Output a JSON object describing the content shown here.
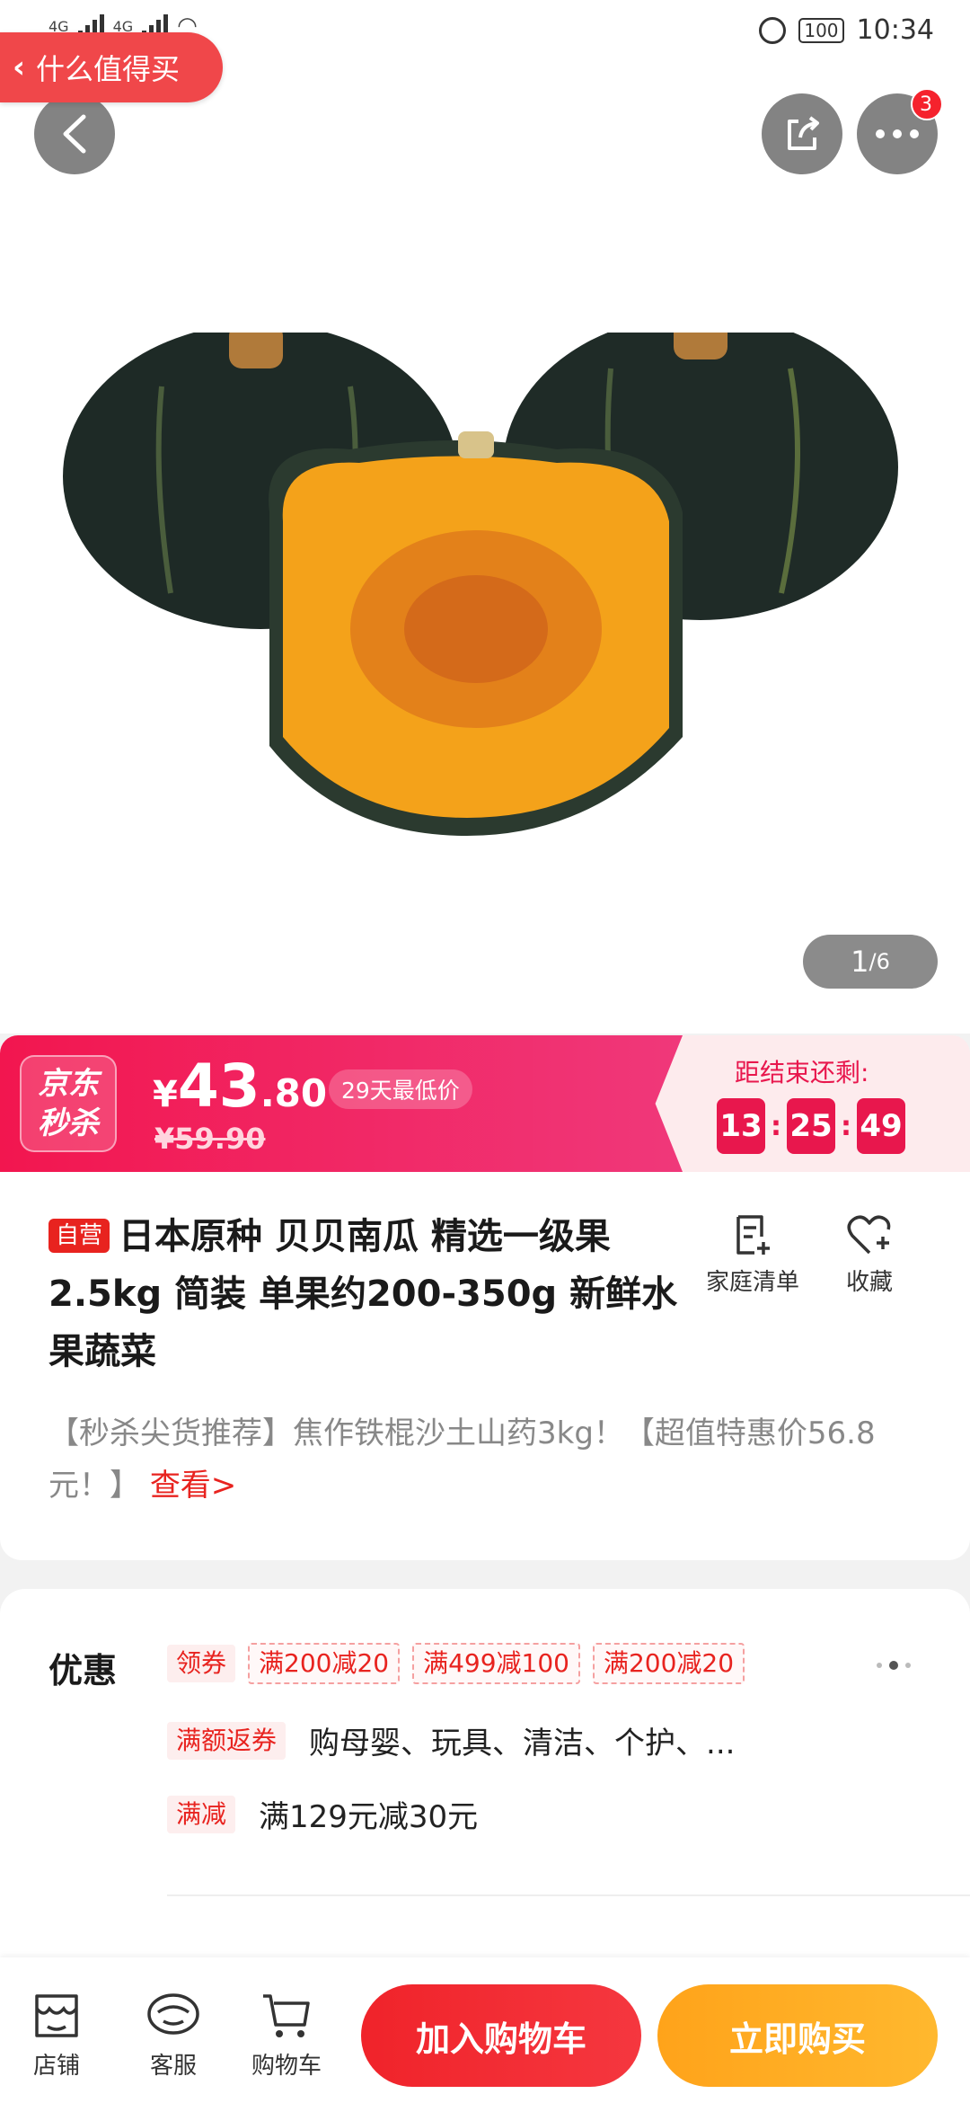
{
  "status_bar": {
    "time": "10:34",
    "battery": "100",
    "network_1": "4G",
    "network_2": "4G"
  },
  "return_to": {
    "label": "什么值得买"
  },
  "header": {
    "more_badge": "3"
  },
  "gallery": {
    "current": "1",
    "total": "/6"
  },
  "flash_sale": {
    "logo_line1": "京东",
    "logo_line2": "秒杀",
    "currency": "¥",
    "price_int": "43",
    "price_dec": ".80",
    "lowest_label": "29天最低价",
    "original_price": "¥59.90",
    "countdown_label": "距结束还剩:",
    "countdown": {
      "h": "13",
      "m": "25",
      "s": "49"
    }
  },
  "product": {
    "self_tag": "自营",
    "title": "日本原种 贝贝南瓜  精选一级果  2.5kg 简装  单果约200-350g 新鲜水果蔬菜",
    "home_list_label": "家庭清单",
    "favorite_label": "收藏",
    "promo_text": "【秒杀尖货推荐】焦作铁棍沙土山药3kg！【超值特惠价56.8元！】",
    "promo_link": "查看>"
  },
  "offers": {
    "label": "优惠",
    "coupon_tag": "领券",
    "coupons": [
      "满200减20",
      "满499减100",
      "满200减20"
    ],
    "rebate_tag": "满额返券",
    "rebate_text": "购母婴、玩具、清洁、个护、...",
    "discount_tag": "满减",
    "discount_text": "满129元减30元"
  },
  "bottom_bar": {
    "store": "店铺",
    "service": "客服",
    "cart": "购物车",
    "add_to_cart": "加入购物车",
    "buy_now": "立即购买"
  },
  "colors": {
    "jd_red": "#e8231f",
    "flash_pink": "#f2164f",
    "buy_orange": "#ffa31a"
  }
}
